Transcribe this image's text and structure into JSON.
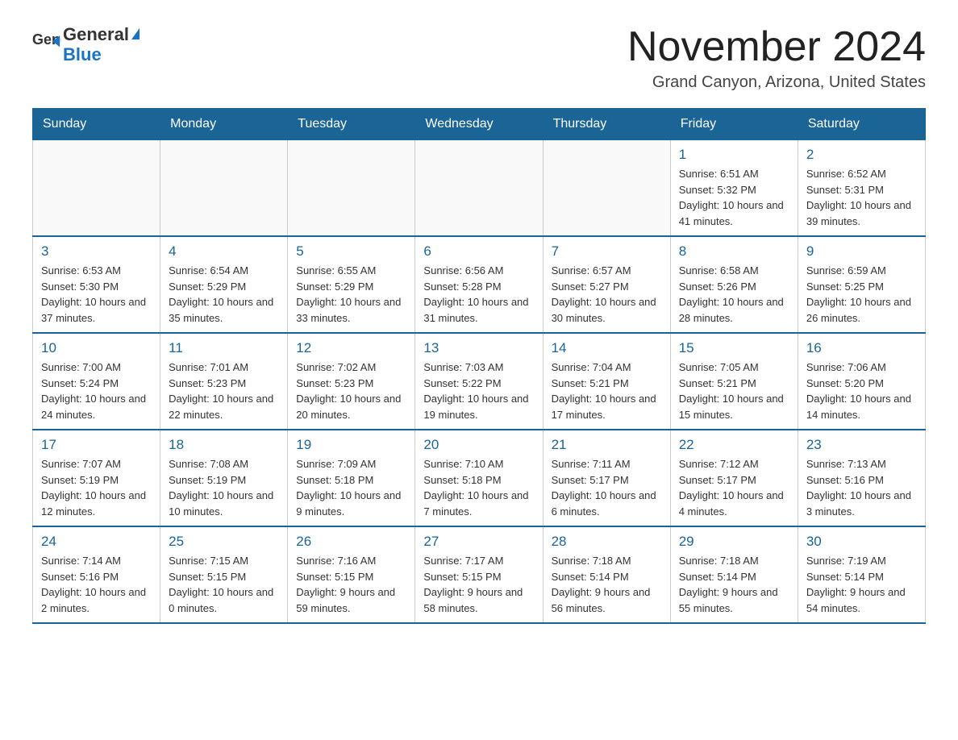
{
  "logo": {
    "text_general": "General",
    "text_blue": "Blue"
  },
  "header": {
    "title": "November 2024",
    "subtitle": "Grand Canyon, Arizona, United States"
  },
  "weekdays": [
    "Sunday",
    "Monday",
    "Tuesday",
    "Wednesday",
    "Thursday",
    "Friday",
    "Saturday"
  ],
  "weeks": [
    [
      {
        "day": "",
        "info": ""
      },
      {
        "day": "",
        "info": ""
      },
      {
        "day": "",
        "info": ""
      },
      {
        "day": "",
        "info": ""
      },
      {
        "day": "",
        "info": ""
      },
      {
        "day": "1",
        "info": "Sunrise: 6:51 AM\nSunset: 5:32 PM\nDaylight: 10 hours and 41 minutes."
      },
      {
        "day": "2",
        "info": "Sunrise: 6:52 AM\nSunset: 5:31 PM\nDaylight: 10 hours and 39 minutes."
      }
    ],
    [
      {
        "day": "3",
        "info": "Sunrise: 6:53 AM\nSunset: 5:30 PM\nDaylight: 10 hours and 37 minutes."
      },
      {
        "day": "4",
        "info": "Sunrise: 6:54 AM\nSunset: 5:29 PM\nDaylight: 10 hours and 35 minutes."
      },
      {
        "day": "5",
        "info": "Sunrise: 6:55 AM\nSunset: 5:29 PM\nDaylight: 10 hours and 33 minutes."
      },
      {
        "day": "6",
        "info": "Sunrise: 6:56 AM\nSunset: 5:28 PM\nDaylight: 10 hours and 31 minutes."
      },
      {
        "day": "7",
        "info": "Sunrise: 6:57 AM\nSunset: 5:27 PM\nDaylight: 10 hours and 30 minutes."
      },
      {
        "day": "8",
        "info": "Sunrise: 6:58 AM\nSunset: 5:26 PM\nDaylight: 10 hours and 28 minutes."
      },
      {
        "day": "9",
        "info": "Sunrise: 6:59 AM\nSunset: 5:25 PM\nDaylight: 10 hours and 26 minutes."
      }
    ],
    [
      {
        "day": "10",
        "info": "Sunrise: 7:00 AM\nSunset: 5:24 PM\nDaylight: 10 hours and 24 minutes."
      },
      {
        "day": "11",
        "info": "Sunrise: 7:01 AM\nSunset: 5:23 PM\nDaylight: 10 hours and 22 minutes."
      },
      {
        "day": "12",
        "info": "Sunrise: 7:02 AM\nSunset: 5:23 PM\nDaylight: 10 hours and 20 minutes."
      },
      {
        "day": "13",
        "info": "Sunrise: 7:03 AM\nSunset: 5:22 PM\nDaylight: 10 hours and 19 minutes."
      },
      {
        "day": "14",
        "info": "Sunrise: 7:04 AM\nSunset: 5:21 PM\nDaylight: 10 hours and 17 minutes."
      },
      {
        "day": "15",
        "info": "Sunrise: 7:05 AM\nSunset: 5:21 PM\nDaylight: 10 hours and 15 minutes."
      },
      {
        "day": "16",
        "info": "Sunrise: 7:06 AM\nSunset: 5:20 PM\nDaylight: 10 hours and 14 minutes."
      }
    ],
    [
      {
        "day": "17",
        "info": "Sunrise: 7:07 AM\nSunset: 5:19 PM\nDaylight: 10 hours and 12 minutes."
      },
      {
        "day": "18",
        "info": "Sunrise: 7:08 AM\nSunset: 5:19 PM\nDaylight: 10 hours and 10 minutes."
      },
      {
        "day": "19",
        "info": "Sunrise: 7:09 AM\nSunset: 5:18 PM\nDaylight: 10 hours and 9 minutes."
      },
      {
        "day": "20",
        "info": "Sunrise: 7:10 AM\nSunset: 5:18 PM\nDaylight: 10 hours and 7 minutes."
      },
      {
        "day": "21",
        "info": "Sunrise: 7:11 AM\nSunset: 5:17 PM\nDaylight: 10 hours and 6 minutes."
      },
      {
        "day": "22",
        "info": "Sunrise: 7:12 AM\nSunset: 5:17 PM\nDaylight: 10 hours and 4 minutes."
      },
      {
        "day": "23",
        "info": "Sunrise: 7:13 AM\nSunset: 5:16 PM\nDaylight: 10 hours and 3 minutes."
      }
    ],
    [
      {
        "day": "24",
        "info": "Sunrise: 7:14 AM\nSunset: 5:16 PM\nDaylight: 10 hours and 2 minutes."
      },
      {
        "day": "25",
        "info": "Sunrise: 7:15 AM\nSunset: 5:15 PM\nDaylight: 10 hours and 0 minutes."
      },
      {
        "day": "26",
        "info": "Sunrise: 7:16 AM\nSunset: 5:15 PM\nDaylight: 9 hours and 59 minutes."
      },
      {
        "day": "27",
        "info": "Sunrise: 7:17 AM\nSunset: 5:15 PM\nDaylight: 9 hours and 58 minutes."
      },
      {
        "day": "28",
        "info": "Sunrise: 7:18 AM\nSunset: 5:14 PM\nDaylight: 9 hours and 56 minutes."
      },
      {
        "day": "29",
        "info": "Sunrise: 7:18 AM\nSunset: 5:14 PM\nDaylight: 9 hours and 55 minutes."
      },
      {
        "day": "30",
        "info": "Sunrise: 7:19 AM\nSunset: 5:14 PM\nDaylight: 9 hours and 54 minutes."
      }
    ]
  ]
}
